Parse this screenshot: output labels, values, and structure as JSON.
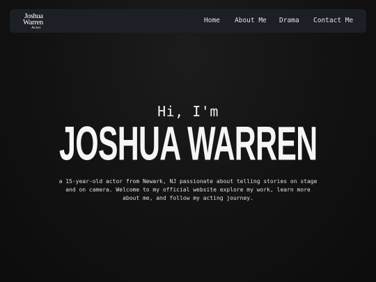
{
  "logo": {
    "first": "Joshua",
    "last": "Warren",
    "subtitle": "Actor"
  },
  "nav": {
    "items": [
      {
        "label": "Home"
      },
      {
        "label": "About Me"
      },
      {
        "label": "Drama"
      },
      {
        "label": "Contact Me"
      }
    ]
  },
  "hero": {
    "greeting": "Hi, I'm",
    "name": "JOSHUA WARREN",
    "bio": "a 15-year-old actor from Newark, NJ passionate about telling stories on stage and on camera. Welcome to my official website explore my work, learn more about me, and follow my acting journey."
  },
  "colors": {
    "background": "#121212",
    "navbar": "#1c1f25",
    "text": "#f5f5f5"
  }
}
